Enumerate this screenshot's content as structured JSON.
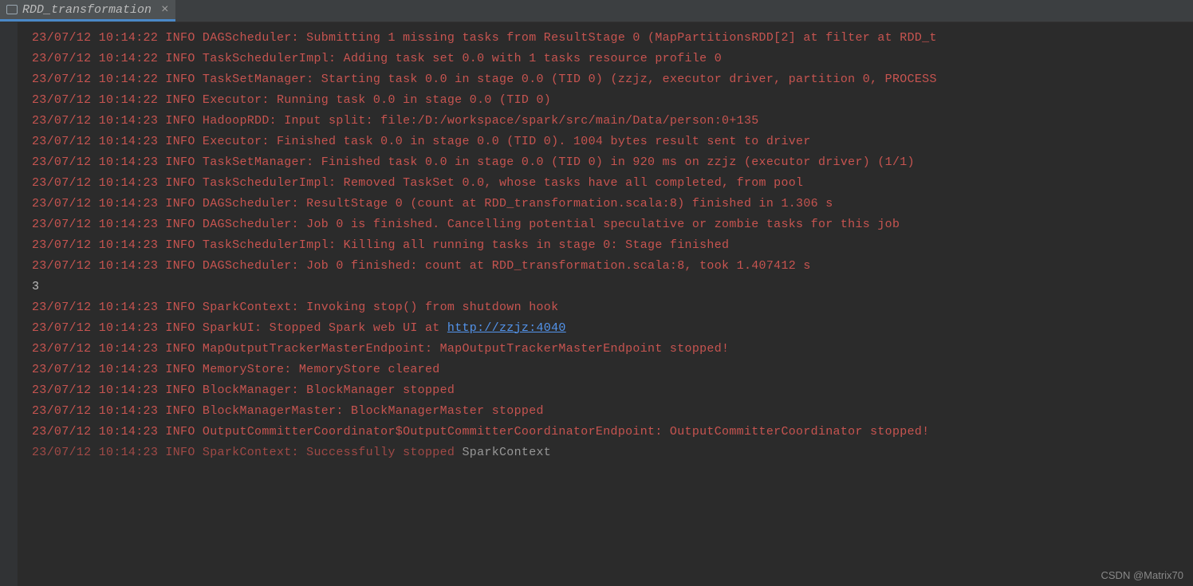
{
  "tab": {
    "title": "RDD_transformation",
    "close_symbol": "×"
  },
  "watermark": "CSDN @Matrix70",
  "console": {
    "lines": [
      {
        "type": "log",
        "text": "23/07/12 10:14:22 INFO DAGScheduler: Submitting 1 missing tasks from ResultStage 0 (MapPartitionsRDD[2] at filter at RDD_t"
      },
      {
        "type": "log",
        "text": "23/07/12 10:14:22 INFO TaskSchedulerImpl: Adding task set 0.0 with 1 tasks resource profile 0"
      },
      {
        "type": "log",
        "text": "23/07/12 10:14:22 INFO TaskSetManager: Starting task 0.0 in stage 0.0 (TID 0) (zzjz, executor driver, partition 0, PROCESS"
      },
      {
        "type": "log",
        "text": "23/07/12 10:14:22 INFO Executor: Running task 0.0 in stage 0.0 (TID 0)"
      },
      {
        "type": "log",
        "text": "23/07/12 10:14:23 INFO HadoopRDD: Input split: file:/D:/workspace/spark/src/main/Data/person:0+135"
      },
      {
        "type": "log",
        "text": "23/07/12 10:14:23 INFO Executor: Finished task 0.0 in stage 0.0 (TID 0). 1004 bytes result sent to driver"
      },
      {
        "type": "log",
        "text": "23/07/12 10:14:23 INFO TaskSetManager: Finished task 0.0 in stage 0.0 (TID 0) in 920 ms on zzjz (executor driver) (1/1)"
      },
      {
        "type": "log",
        "text": "23/07/12 10:14:23 INFO TaskSchedulerImpl: Removed TaskSet 0.0, whose tasks have all completed, from pool"
      },
      {
        "type": "log",
        "text": "23/07/12 10:14:23 INFO DAGScheduler: ResultStage 0 (count at RDD_transformation.scala:8) finished in 1.306 s"
      },
      {
        "type": "log",
        "text": "23/07/12 10:14:23 INFO DAGScheduler: Job 0 is finished. Cancelling potential speculative or zombie tasks for this job"
      },
      {
        "type": "log",
        "text": "23/07/12 10:14:23 INFO TaskSchedulerImpl: Killing all running tasks in stage 0: Stage finished"
      },
      {
        "type": "log",
        "text": "23/07/12 10:14:23 INFO DAGScheduler: Job 0 finished: count at RDD_transformation.scala:8, took 1.407412 s"
      },
      {
        "type": "output",
        "text": "3"
      },
      {
        "type": "log",
        "text": "23/07/12 10:14:23 INFO SparkContext: Invoking stop() from shutdown hook"
      },
      {
        "type": "log_link",
        "prefix": "23/07/12 10:14:23 INFO SparkUI: Stopped Spark web UI at ",
        "link_text": "http://zzjz:4040",
        "link_href": "http://zzjz:4040"
      },
      {
        "type": "log",
        "text": "23/07/12 10:14:23 INFO MapOutputTrackerMasterEndpoint: MapOutputTrackerMasterEndpoint stopped!"
      },
      {
        "type": "log",
        "text": "23/07/12 10:14:23 INFO MemoryStore: MemoryStore cleared"
      },
      {
        "type": "log",
        "text": "23/07/12 10:14:23 INFO BlockManager: BlockManager stopped"
      },
      {
        "type": "log",
        "text": "23/07/12 10:14:23 INFO BlockManagerMaster: BlockManagerMaster stopped"
      },
      {
        "type": "log",
        "text": "23/07/12 10:14:23 INFO OutputCommitterCoordinator$OutputCommitterCoordinatorEndpoint: OutputCommitterCoordinator stopped!"
      },
      {
        "type": "log_tail",
        "text": "23/07/12 10:14:23 INFO SparkContext: Successfully stopped ",
        "tail": "SparkContext",
        "faded": true
      }
    ]
  }
}
